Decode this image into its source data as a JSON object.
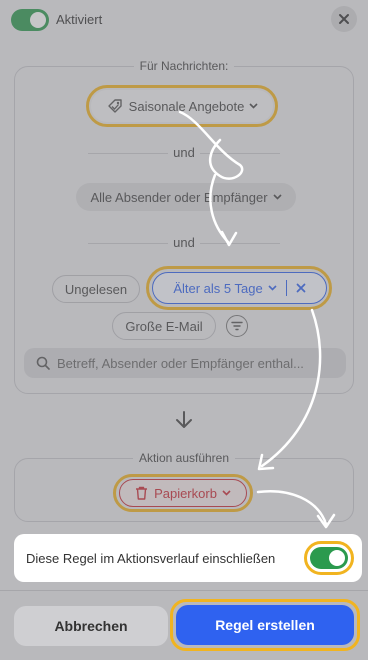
{
  "header": {
    "toggle_label": "Aktiviert"
  },
  "conditions": {
    "section_label": "Für Nachrichten:",
    "category": "Saisonale Angebote",
    "and_1": "und",
    "sender": "Alle Absender oder Empfänger",
    "and_2": "und",
    "unread": "Ungelesen",
    "age": "Älter als 5 Tage",
    "large_mail": "Große E-Mail",
    "search_placeholder": "Betreff, Absender oder Empfänger enthal..."
  },
  "action": {
    "section_label": "Aktion ausführen",
    "trash": "Papierkorb"
  },
  "history": {
    "label": "Diese Regel im Aktionsverlauf einschließen",
    "enabled": true
  },
  "footer": {
    "cancel_label": "Abbrechen",
    "create_label": "Regel erstellen"
  },
  "colors": {
    "accent_blue": "#2f62f0",
    "toggle_green": "#2b9a4e",
    "highlight": "#f1b420",
    "danger_red": "#cc2a35"
  }
}
